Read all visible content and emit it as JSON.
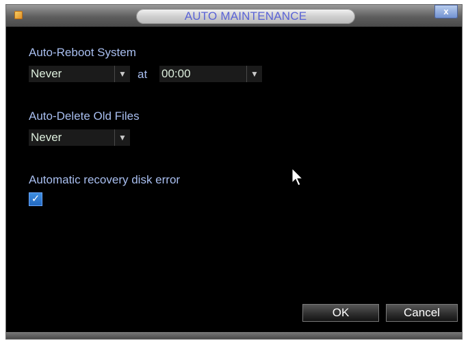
{
  "window": {
    "title": "AUTO MAINTENANCE",
    "close_label": "x"
  },
  "auto_reboot": {
    "label": "Auto-Reboot System",
    "frequency": "Never",
    "at_label": "at",
    "time": "00:00"
  },
  "auto_delete": {
    "label": "Auto-Delete Old Files",
    "frequency": "Never"
  },
  "disk_recovery": {
    "label": "Automatic recovery disk error",
    "checked": true,
    "check_glyph": "✓"
  },
  "buttons": {
    "ok": "OK",
    "cancel": "Cancel"
  },
  "icons": {
    "dropdown": "▼"
  },
  "colors": {
    "title_text": "#5a63d6",
    "label_text": "#a9bff0",
    "value_text": "#ddeedd",
    "background": "#000000"
  }
}
